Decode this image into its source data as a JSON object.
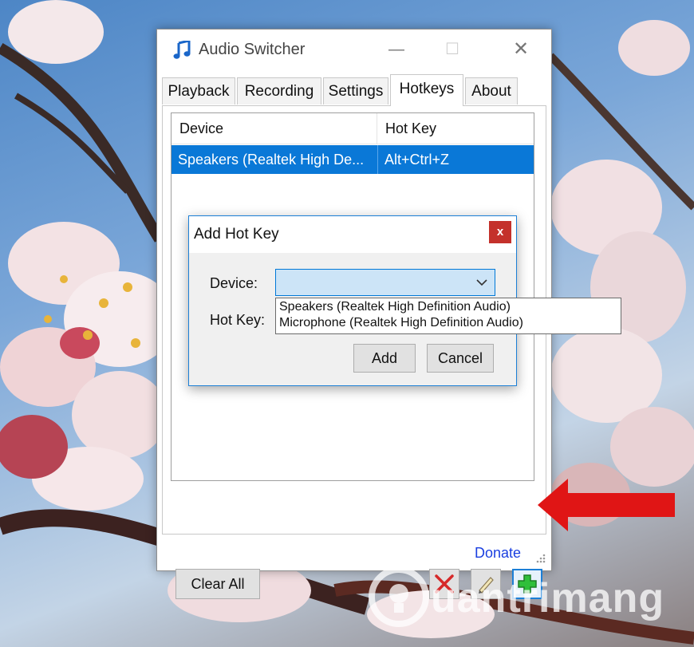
{
  "window": {
    "title": "Audio Switcher",
    "controls": {
      "minimize": "—",
      "maximize": "☐",
      "close": "✕"
    }
  },
  "tabs": [
    {
      "label": "Playback",
      "active": false
    },
    {
      "label": "Recording",
      "active": false
    },
    {
      "label": "Settings",
      "active": false
    },
    {
      "label": "Hotkeys",
      "active": true
    },
    {
      "label": "About",
      "active": false
    }
  ],
  "hotkeys_table": {
    "columns": [
      "Device",
      "Hot Key"
    ],
    "rows": [
      {
        "device": "Speakers (Realtek High De...",
        "hotkey": "Alt+Ctrl+Z",
        "selected": true
      }
    ]
  },
  "buttons": {
    "clear_all": "Clear All",
    "delete_icon": "delete-x-icon",
    "edit_icon": "pencil-icon",
    "add_icon": "green-plus-icon"
  },
  "footer": {
    "donate": "Donate"
  },
  "dialog": {
    "title": "Add Hot Key",
    "close": "x",
    "device_label": "Device:",
    "hotkey_label": "Hot Key:",
    "device_value": "",
    "device_options": [
      "Speakers (Realtek High Definition Audio)",
      "Microphone (Realtek High Definition Audio)"
    ],
    "add_button": "Add",
    "cancel_button": "Cancel"
  },
  "watermark": {
    "text": "uantrimang"
  },
  "colors": {
    "selection": "#0a78d7",
    "accent": "#1c7fd6",
    "close_red": "#c4312b",
    "arrow_red": "#e01515",
    "plus_green": "#2fbf3a",
    "delete_red": "#d62a2a",
    "link_blue": "#1a3fe0"
  }
}
